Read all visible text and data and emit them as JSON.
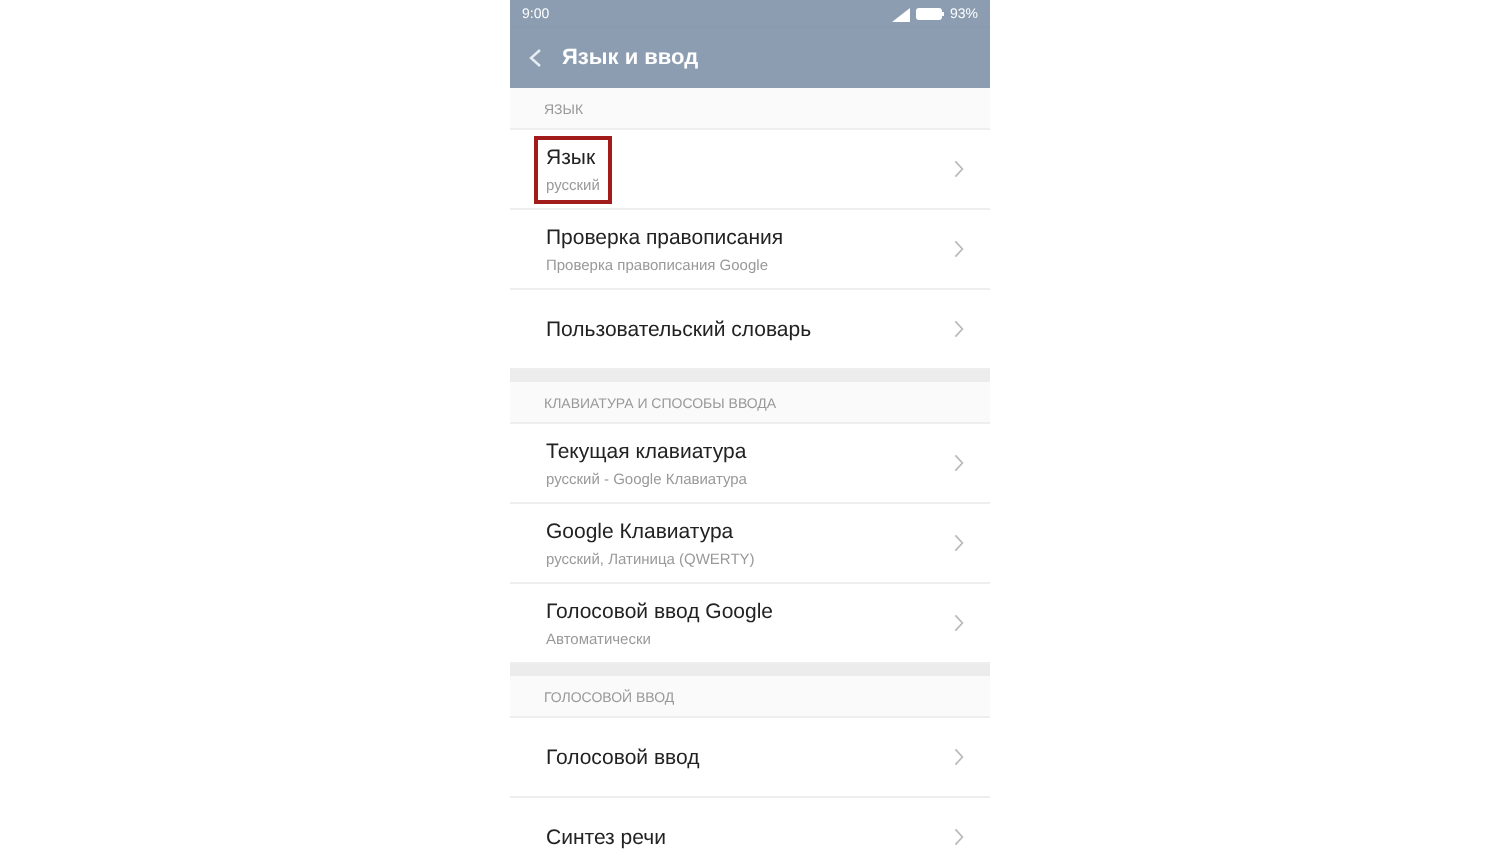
{
  "status_bar": {
    "time": "9:00",
    "battery": "93%"
  },
  "app_bar": {
    "title": "Язык и ввод"
  },
  "sections": [
    {
      "header": "ЯЗЫК",
      "items": [
        {
          "title": "Язык",
          "subtitle": "русский",
          "highlighted": true
        },
        {
          "title": "Проверка правописания",
          "subtitle": "Проверка правописания Google",
          "highlighted": false
        },
        {
          "title": "Пользовательский словарь",
          "highlighted": false
        }
      ]
    },
    {
      "header": "КЛАВИАТУРА И СПОСОБЫ ВВОДА",
      "items": [
        {
          "title": "Текущая клавиатура",
          "subtitle": "русский - Google Клавиатура",
          "highlighted": false
        },
        {
          "title": "Google Клавиатура",
          "subtitle": "русский, Латиница (QWERTY)",
          "highlighted": false
        },
        {
          "title": "Голосовой ввод Google",
          "subtitle": "Автоматически",
          "highlighted": false
        }
      ]
    },
    {
      "header": "ГОЛОСОВОЙ ВВОД",
      "items": [
        {
          "title": "Голосовой ввод",
          "highlighted": false
        },
        {
          "title": "Синтез речи",
          "highlighted": false
        }
      ]
    }
  ]
}
